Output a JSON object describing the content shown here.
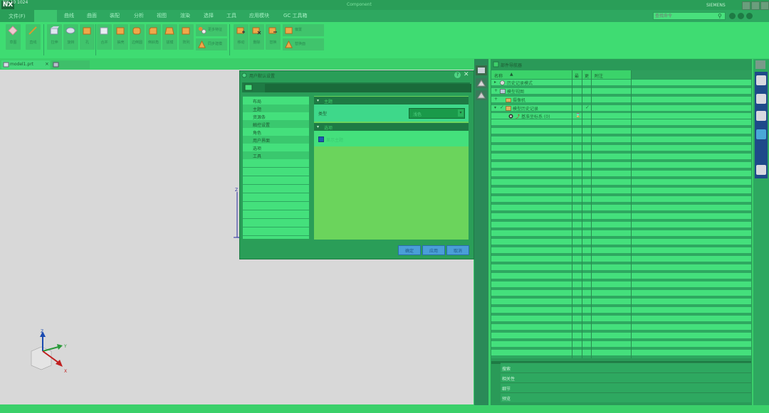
{
  "window": {
    "top_left_label": "NX 10 1024",
    "logo": "NX",
    "document_title": "Component",
    "user_label": "SIEMENS"
  },
  "menubar": {
    "file_label": "文件(F)",
    "items": [
      "曲线",
      "曲面",
      "装配",
      "分析",
      "视图",
      "渲染",
      "选择",
      "工具",
      "应用模块",
      "GC 工具箱"
    ],
    "search_placeholder": "查找命令"
  },
  "ribbon": {
    "buttons": [
      "草图",
      "直线",
      "拉伸",
      "旋转",
      "孔",
      "合并",
      "抽壳",
      "边倒圆",
      "倒斜角",
      "拔模",
      "阵列"
    ],
    "wide_buttons": [
      "更多特征",
      "同步建模",
      "移动",
      "删除",
      "替换",
      "偏置",
      "替换面"
    ]
  },
  "tabs": {
    "part_tab": "model1.prt",
    "second_tab": ""
  },
  "canvas": {
    "axis_z": "Z",
    "axis_x": "X",
    "axis_y": "Y"
  },
  "resource_panel": {
    "title": "部件导航器",
    "columns": [
      "名称",
      "最",
      "更",
      "附注"
    ],
    "tree": [
      {
        "label": "历史记录模式",
        "indent": 0
      },
      {
        "label": "模型视图",
        "indent": 0
      },
      {
        "label": "摄像机",
        "indent": 1
      },
      {
        "label": "模型历史记录",
        "indent": 0
      },
      {
        "label": "基准坐标系 (0)",
        "indent": 1
      }
    ],
    "bottom_sections": [
      "搜索",
      "相关性",
      "细节",
      "预览"
    ]
  },
  "dialog": {
    "title": "用户默认设置",
    "left_items": [
      "布局",
      "主题",
      "资源条",
      "触控设置",
      "角色",
      "用户界面",
      "选项",
      "工具"
    ],
    "section1_title": "主题",
    "type_label": "类型",
    "type_value": "浅色",
    "section2_title": "选项",
    "option_label": "显示主题",
    "buttons": {
      "ok": "确定",
      "apply": "应用",
      "cancel": "取消"
    }
  },
  "colors": {
    "canvas_bg": "#d8d8d8",
    "ribbon_bg": "#3fdc72",
    "dialog_bg": "#2a9e58",
    "accent_blue": "#4a9ed8"
  }
}
